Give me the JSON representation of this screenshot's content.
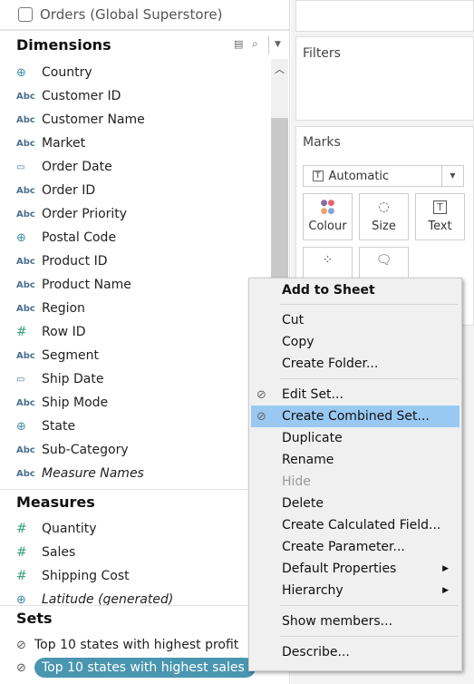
{
  "datasource": {
    "name": "Orders (Global Superstore)",
    "icon": "datasource-icon"
  },
  "dimensions": {
    "title": "Dimensions",
    "items": [
      {
        "label": "Country",
        "type": "geo"
      },
      {
        "label": "Customer ID",
        "type": "abc"
      },
      {
        "label": "Customer Name",
        "type": "abc"
      },
      {
        "label": "Market",
        "type": "abc"
      },
      {
        "label": "Order Date",
        "type": "date"
      },
      {
        "label": "Order ID",
        "type": "abc"
      },
      {
        "label": "Order Priority",
        "type": "abc"
      },
      {
        "label": "Postal Code",
        "type": "geo"
      },
      {
        "label": "Product ID",
        "type": "abc"
      },
      {
        "label": "Product Name",
        "type": "abc"
      },
      {
        "label": "Region",
        "type": "abc"
      },
      {
        "label": "Row ID",
        "type": "num"
      },
      {
        "label": "Segment",
        "type": "abc"
      },
      {
        "label": "Ship Date",
        "type": "date"
      },
      {
        "label": "Ship Mode",
        "type": "abc"
      },
      {
        "label": "State",
        "type": "geo"
      },
      {
        "label": "Sub-Category",
        "type": "abc"
      },
      {
        "label": "Measure Names",
        "type": "abc",
        "italic": true
      }
    ]
  },
  "measures": {
    "title": "Measures",
    "items": [
      {
        "label": "Quantity",
        "type": "num"
      },
      {
        "label": "Sales",
        "type": "num"
      },
      {
        "label": "Shipping Cost",
        "type": "num"
      },
      {
        "label": "Latitude (generated)",
        "type": "geo",
        "italic": true
      }
    ]
  },
  "sets": {
    "title": "Sets",
    "items": [
      {
        "label": "Top 10 states with highest profit",
        "selected": false
      },
      {
        "label": "Top 10 states with highest sales",
        "selected": true
      }
    ]
  },
  "filters": {
    "title": "Filters"
  },
  "marks": {
    "title": "Marks",
    "type_select": "Automatic",
    "buttons": [
      {
        "label": "Colour",
        "icon": "colour-icon"
      },
      {
        "label": "Size",
        "icon": "size-icon"
      },
      {
        "label": "Text",
        "icon": "text-icon"
      },
      {
        "label": "",
        "icon": "detail-icon"
      },
      {
        "label": "",
        "icon": "tooltip-icon"
      }
    ]
  },
  "context_menu": {
    "items": [
      {
        "label": "Add to Sheet",
        "bold": true
      },
      {
        "sep": true
      },
      {
        "label": "Cut"
      },
      {
        "label": "Copy"
      },
      {
        "label": "Create Folder..."
      },
      {
        "sep": true
      },
      {
        "label": "Edit Set...",
        "icon": "set-icon"
      },
      {
        "label": "Create Combined Set...",
        "icon": "set-icon",
        "highlighted": true
      },
      {
        "label": "Duplicate"
      },
      {
        "label": "Rename"
      },
      {
        "label": "Hide",
        "disabled": true
      },
      {
        "label": "Delete"
      },
      {
        "label": "Create Calculated Field..."
      },
      {
        "label": "Create Parameter..."
      },
      {
        "label": "Default Properties",
        "submenu": true
      },
      {
        "label": "Hierarchy",
        "submenu": true
      },
      {
        "sep": true
      },
      {
        "label": "Show members..."
      },
      {
        "sep": true
      },
      {
        "label": "Describe..."
      }
    ]
  },
  "colors": {
    "selected_set": "#4a96b0",
    "menu_highlight": "#99c9f3",
    "dimension_icon": "#4a6f8f",
    "measure_icon": "#3aa07a"
  }
}
